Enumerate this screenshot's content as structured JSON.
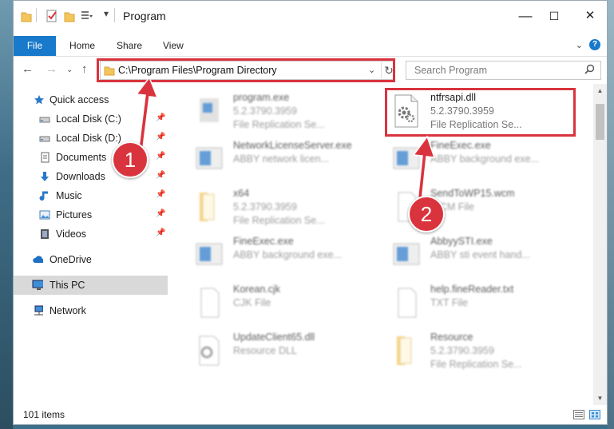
{
  "window": {
    "title": "Program",
    "controls": {
      "minimize": "—",
      "maximize": "☐",
      "close": "✕"
    }
  },
  "ribbon": {
    "tabs": [
      "File",
      "Home",
      "Share",
      "View"
    ]
  },
  "address": {
    "path": "C:\\Program Files\\Program Directory",
    "search_placeholder": "Search Program"
  },
  "nav": {
    "items": [
      {
        "label": "Quick access",
        "icon": "star-icon",
        "pinned": false
      },
      {
        "label": "Local Disk (C:)",
        "icon": "drive-icon",
        "pinned": true
      },
      {
        "label": "Local Disk (D:)",
        "icon": "drive-icon",
        "pinned": true
      },
      {
        "label": "Documents",
        "icon": "documents-icon",
        "pinned": true
      },
      {
        "label": "Downloads",
        "icon": "download-icon",
        "pinned": true
      },
      {
        "label": "Music",
        "icon": "music-icon",
        "pinned": true
      },
      {
        "label": "Pictures",
        "icon": "pictures-icon",
        "pinned": true
      },
      {
        "label": "Videos",
        "icon": "videos-icon",
        "pinned": true
      },
      {
        "label": "OneDrive",
        "icon": "cloud-icon",
        "pinned": false
      },
      {
        "label": "This PC",
        "icon": "computer-icon",
        "pinned": false,
        "selected": true
      },
      {
        "label": "Network",
        "icon": "network-icon",
        "pinned": false
      }
    ]
  },
  "files": [
    {
      "name": "program.exe",
      "line2": "5.2.3790.3959",
      "line3": "File Replication Se...",
      "icon": "exe-icon",
      "blurred": true
    },
    {
      "name": "ntfrsapi.dll",
      "line2": "5.2.3790.3959",
      "line3": "File Replication Se...",
      "icon": "dll-icon",
      "blurred": false
    },
    {
      "name": "NetworkLicenseServer.exe",
      "line2": "ABBY network licen...",
      "line3": "",
      "icon": "app-icon",
      "blurred": true
    },
    {
      "name": "FineExec.exe",
      "line2": "ABBY background exe...",
      "line3": "",
      "icon": "app-icon",
      "blurred": true
    },
    {
      "name": "x64",
      "line2": "5.2.3790.3959",
      "line3": "File Replication Se...",
      "icon": "folder-icon",
      "blurred": true
    },
    {
      "name": "SendToWP15.wcm",
      "line2": "WCM File",
      "line3": "",
      "icon": "file-icon",
      "blurred": true
    },
    {
      "name": "FineExec.exe",
      "line2": "ABBY background exe...",
      "line3": "",
      "icon": "app-icon",
      "blurred": true
    },
    {
      "name": "AbbyySTI.exe",
      "line2": "ABBY sti event hand...",
      "line3": "",
      "icon": "app-icon",
      "blurred": true
    },
    {
      "name": "Korean.cjk",
      "line2": "CJK File",
      "line3": "",
      "icon": "file-icon",
      "blurred": true
    },
    {
      "name": "help.fineReader.txt",
      "line2": "TXT File",
      "line3": "",
      "icon": "file-icon",
      "blurred": true
    },
    {
      "name": "UpdateClient65.dll",
      "line2": "Resource DLL",
      "line3": "",
      "icon": "dll-icon",
      "blurred": true
    },
    {
      "name": "Resource",
      "line2": "5.2.3790.3959",
      "line3": "File Replication Se...",
      "icon": "folder-icon",
      "blurred": true
    }
  ],
  "status": {
    "item_count": "101 items"
  },
  "callouts": {
    "one": "1",
    "two": "2"
  },
  "colors": {
    "accent": "#1979ca",
    "highlight": "#d9343e"
  }
}
